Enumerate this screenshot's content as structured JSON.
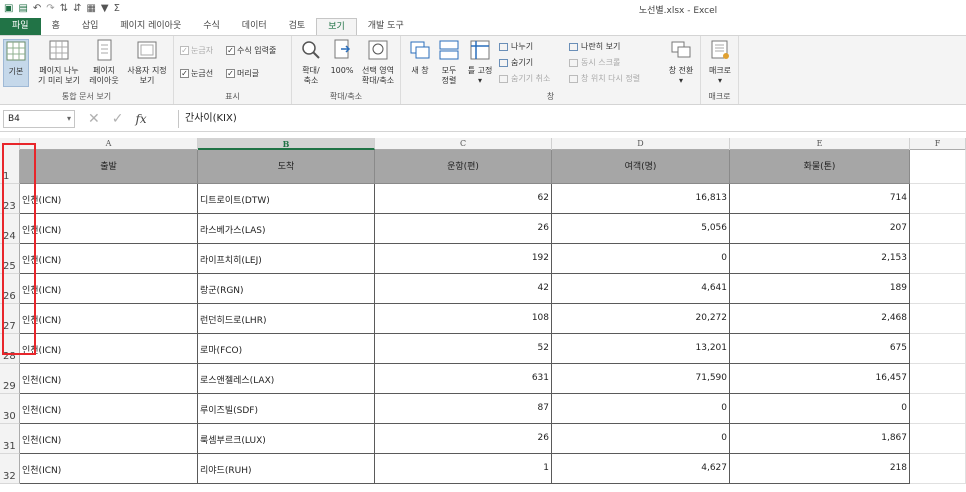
{
  "window": {
    "title": "노선별.xlsx - Excel"
  },
  "quick_access": {
    "icons": [
      "excel-icon",
      "save-icon",
      "undo-icon",
      "redo-icon",
      "sort-asc-icon",
      "sort-desc-icon",
      "form-icon",
      "filter-icon",
      "autosum-icon"
    ]
  },
  "tabs": [
    {
      "label": "파일"
    },
    {
      "label": "홈"
    },
    {
      "label": "삽입"
    },
    {
      "label": "페이지 레이아웃"
    },
    {
      "label": "수식"
    },
    {
      "label": "데이터"
    },
    {
      "label": "검토"
    },
    {
      "label": "보기"
    },
    {
      "label": "개발 도구"
    }
  ],
  "ribbon": {
    "workbook_views": {
      "label": "통합 문서 보기",
      "normal": "기본",
      "page_break_l1": "페이지 나누",
      "page_break_l2": "기 미리 보기",
      "page_layout_l1": "페이지",
      "page_layout_l2": "레이아웃",
      "custom_l1": "사용자 지정",
      "custom_l2": "보기"
    },
    "show": {
      "label": "표시",
      "ruler": "눈금자",
      "formula_bar": "수식 입력줄",
      "gridlines": "눈금선",
      "headings": "머리글"
    },
    "zoom": {
      "label": "확대/축소",
      "zoom_l1": "확대/",
      "zoom_l2": "축소",
      "zoom100": "100%",
      "selection_l1": "선택 영역",
      "selection_l2": "확대/축소"
    },
    "window": {
      "label": "창",
      "new_window": "새 창",
      "arrange_l1": "모두",
      "arrange_l2": "정렬",
      "freeze": "틀 고정",
      "split": "나누기",
      "hide": "숨기기",
      "unhide": "숨기기 취소",
      "side_by_side": "나란히 보기",
      "sync_scroll": "동시 스크롤",
      "reset_pos": "창 위치 다시 정렬",
      "switch": "창 전환"
    },
    "macros": {
      "label": "매크로",
      "button": "매크로"
    }
  },
  "formula_bar": {
    "name_box": "B4",
    "fx": "fx",
    "content": "간사이(KIX)"
  },
  "columns": [
    "A",
    "B",
    "C",
    "D",
    "E",
    "F"
  ],
  "header_row": {
    "number": "1",
    "cells": [
      "출발",
      "도착",
      "운항(편)",
      "여객(명)",
      "화물(톤)"
    ]
  },
  "rows": [
    {
      "num": "23",
      "from": "인천(ICN)",
      "to": "디트로이트(DTW)",
      "flights": "62",
      "passengers": "16,813",
      "cargo": "714"
    },
    {
      "num": "24",
      "from": "인천(ICN)",
      "to": "라스베가스(LAS)",
      "flights": "26",
      "passengers": "5,056",
      "cargo": "207"
    },
    {
      "num": "25",
      "from": "인천(ICN)",
      "to": "라이프치히(LEJ)",
      "flights": "192",
      "passengers": "0",
      "cargo": "2,153"
    },
    {
      "num": "26",
      "from": "인천(ICN)",
      "to": "랑군(RGN)",
      "flights": "42",
      "passengers": "4,641",
      "cargo": "189"
    },
    {
      "num": "27",
      "from": "인천(ICN)",
      "to": "런던히드로(LHR)",
      "flights": "108",
      "passengers": "20,272",
      "cargo": "2,468"
    },
    {
      "num": "28",
      "from": "인천(ICN)",
      "to": "로마(FCO)",
      "flights": "52",
      "passengers": "13,201",
      "cargo": "675"
    },
    {
      "num": "29",
      "from": "인천(ICN)",
      "to": "로스앤젤레스(LAX)",
      "flights": "631",
      "passengers": "71,590",
      "cargo": "16,457"
    },
    {
      "num": "30",
      "from": "인천(ICN)",
      "to": "루이즈빌(SDF)",
      "flights": "87",
      "passengers": "0",
      "cargo": "0"
    },
    {
      "num": "31",
      "from": "인천(ICN)",
      "to": "룩셈부르크(LUX)",
      "flights": "26",
      "passengers": "0",
      "cargo": "1,867"
    },
    {
      "num": "32",
      "from": "인천(ICN)",
      "to": "리야드(RUH)",
      "flights": "1",
      "passengers": "4,627",
      "cargo": "218"
    }
  ],
  "colors": {
    "excel_green": "#217346",
    "header_fill": "#a6a6a6",
    "annotation_red": "#e8262b"
  }
}
